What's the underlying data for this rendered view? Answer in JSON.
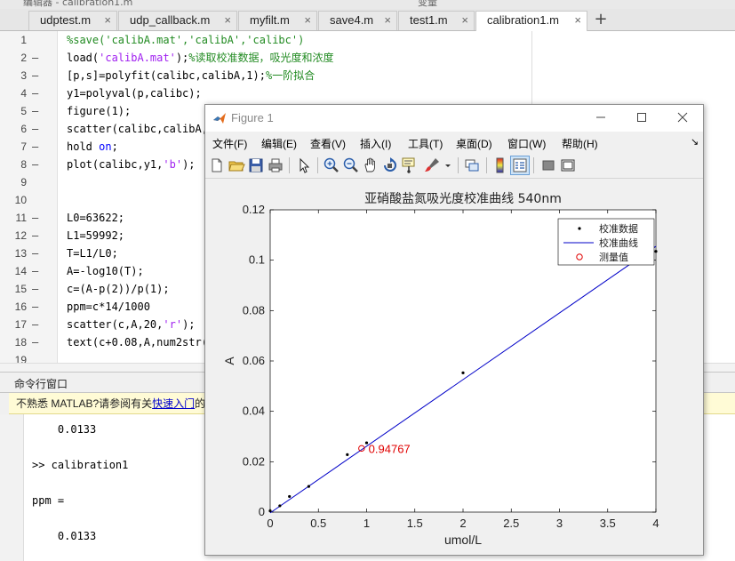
{
  "editor": {
    "title_fragment": "编辑器 - calibration1.m",
    "right_fragment": "变量",
    "tabs": [
      {
        "label": "udptest.m"
      },
      {
        "label": "udp_callback.m"
      },
      {
        "label": "myfilt.m"
      },
      {
        "label": "save4.m"
      },
      {
        "label": "test1.m"
      },
      {
        "label": "calibration1.m",
        "active": true
      }
    ],
    "add_tab": "+",
    "tab_close": "×",
    "breakpoint_mark": "–",
    "lines": [
      {
        "n": "1",
        "bp": false,
        "parts": [
          {
            "t": "%save('calibA.mat','calibA','calibc')",
            "c": "cm"
          }
        ]
      },
      {
        "n": "2",
        "bp": true,
        "parts": [
          {
            "t": "load(",
            "c": ""
          },
          {
            "t": "'calibA.mat'",
            "c": "str"
          },
          {
            "t": ");",
            "c": ""
          },
          {
            "t": "%读取校准数据，吸光度和浓度",
            "c": "cm"
          }
        ]
      },
      {
        "n": "3",
        "bp": true,
        "parts": [
          {
            "t": "[p,s]=polyfit(calibc,calibA,1);",
            "c": ""
          },
          {
            "t": "%一阶拟合",
            "c": "cm"
          }
        ]
      },
      {
        "n": "4",
        "bp": true,
        "parts": [
          {
            "t": "y1=polyval(p,calibc);",
            "c": ""
          }
        ]
      },
      {
        "n": "5",
        "bp": true,
        "parts": [
          {
            "t": "figure(1);",
            "c": ""
          }
        ]
      },
      {
        "n": "6",
        "bp": true,
        "parts": [
          {
            "t": "scatter(calibc,calibA,",
            "c": ""
          }
        ]
      },
      {
        "n": "7",
        "bp": true,
        "parts": [
          {
            "t": "hold ",
            "c": ""
          },
          {
            "t": "on",
            "c": "kw"
          },
          {
            "t": ";",
            "c": ""
          }
        ]
      },
      {
        "n": "8",
        "bp": true,
        "parts": [
          {
            "t": "plot(calibc,y1,",
            "c": ""
          },
          {
            "t": "'b'",
            "c": "str"
          },
          {
            "t": ");",
            "c": ""
          }
        ]
      },
      {
        "n": "9",
        "bp": false,
        "parts": []
      },
      {
        "n": "10",
        "bp": false,
        "parts": []
      },
      {
        "n": "11",
        "bp": true,
        "parts": [
          {
            "t": "L0=63622;",
            "c": ""
          }
        ]
      },
      {
        "n": "12",
        "bp": true,
        "parts": [
          {
            "t": "L1=59992;",
            "c": ""
          }
        ]
      },
      {
        "n": "13",
        "bp": true,
        "parts": [
          {
            "t": "T=L1/L0;",
            "c": ""
          }
        ]
      },
      {
        "n": "14",
        "bp": true,
        "parts": [
          {
            "t": "A=-log10(T);",
            "c": ""
          }
        ]
      },
      {
        "n": "15",
        "bp": true,
        "parts": [
          {
            "t": "c=(A-p(2))/p(1);",
            "c": ""
          }
        ]
      },
      {
        "n": "16",
        "bp": true,
        "parts": [
          {
            "t": "ppm=c*14/1000",
            "c": ""
          }
        ]
      },
      {
        "n": "17",
        "bp": true,
        "parts": [
          {
            "t": "scatter(c,A,20,",
            "c": ""
          },
          {
            "t": "'r'",
            "c": "str"
          },
          {
            "t": ");",
            "c": ""
          }
        ]
      },
      {
        "n": "18",
        "bp": true,
        "parts": [
          {
            "t": "text(c+0.08,A,num2str(c",
            "c": ""
          }
        ]
      },
      {
        "n": "19",
        "bp": false,
        "parts": []
      }
    ]
  },
  "command_window": {
    "header": "命令行窗口",
    "banner_text": "不熟悉 MATLAB?请参阅有关",
    "banner_link": "快速入门",
    "banner_tail": "的",
    "lines": [
      {
        "text": "    0.0133",
        "top": 0
      },
      {
        "text": ">> calibration1",
        "top": 1
      },
      {
        "text": "ppm =",
        "top": 2
      },
      {
        "text": "    0.0133",
        "top": 3
      }
    ]
  },
  "figure": {
    "title": "Figure 1",
    "menu": [
      "文件(F)",
      "编辑(E)",
      "查看(V)",
      "插入(I)",
      "工具(T)",
      "桌面(D)",
      "窗口(W)",
      "帮助(H)"
    ],
    "menu_arrow": "↘",
    "toolbar_icons": [
      "new-figure-icon",
      "open-icon",
      "save-icon",
      "print-icon",
      "pointer-icon",
      "zoom-in-icon",
      "zoom-out-icon",
      "pan-icon",
      "rotate-icon",
      "data-cursor-icon",
      "brush-icon",
      "brush-dropdown-icon",
      "link-icon",
      "colorbar-icon",
      "legend-icon",
      "hide-tools-icon",
      "dock-icon"
    ]
  },
  "chart_data": {
    "type": "scatter",
    "title": "亚硝酸盐氮吸光度校准曲线 540nm",
    "xlabel": "umol/L",
    "ylabel": "A",
    "xlim": [
      0,
      4
    ],
    "ylim": [
      0,
      0.12
    ],
    "xticks": [
      "0",
      "0.5",
      "1",
      "1.5",
      "2",
      "2.5",
      "3",
      "3.5",
      "4"
    ],
    "yticks": [
      "0",
      "0.02",
      "0.04",
      "0.06",
      "0.08",
      "0.1",
      "0.12"
    ],
    "grid": false,
    "legend_position": "top-right",
    "series": [
      {
        "name": "校准数据",
        "kind": "dots",
        "color": "#000000",
        "x": [
          0,
          0.1,
          0.2,
          0.4,
          0.8,
          1.0,
          2.0,
          4.0
        ],
        "y": [
          0.0005,
          0.0025,
          0.0062,
          0.0102,
          0.0228,
          0.0275,
          0.0553,
          0.1035
        ]
      },
      {
        "name": "校准曲线",
        "kind": "line",
        "color": "#0000c8",
        "x": [
          0,
          4.0
        ],
        "y": [
          -0.0003,
          0.1055
        ]
      },
      {
        "name": "测量值",
        "kind": "circle",
        "color": "#e00000",
        "x": [
          0.94767
        ],
        "y": [
          0.0253
        ]
      }
    ],
    "annotations": [
      {
        "text": "0.94767",
        "x": 1.02,
        "y": 0.0253,
        "color": "#e00000"
      }
    ]
  }
}
